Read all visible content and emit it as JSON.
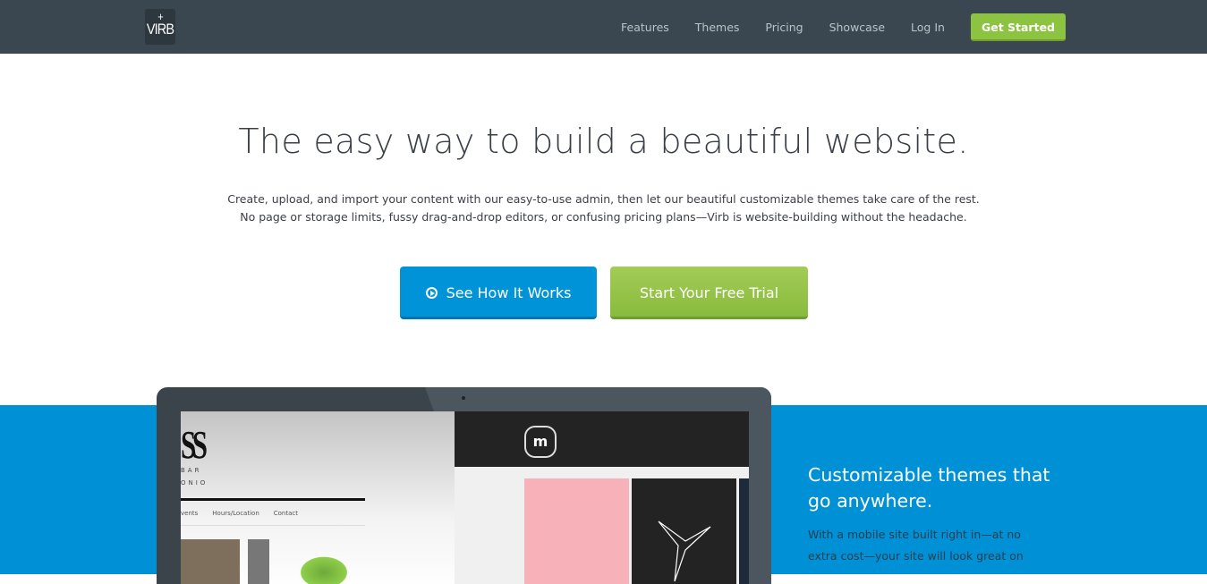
{
  "nav": {
    "logo": "VIRB",
    "logo_mark": "+",
    "links": [
      "Features",
      "Themes",
      "Pricing",
      "Showcase",
      "Log In"
    ],
    "cta": "Get Started"
  },
  "hero": {
    "title": "The easy way to build a beautiful website.",
    "subtitle_lines": [
      "Create, upload, and import your content with our easy-to-use admin, then let our beautiful customizable themes take care of the rest.",
      "No page or storage limits, fussy drag-and-drop editors, or confusing pricing plans—Virb is website-building without the headache."
    ],
    "buttons": {
      "primary": "See How It Works",
      "primary_icon": "play-circle-icon",
      "secondary": "Start Your Free Trial"
    }
  },
  "device": {
    "left_theme": {
      "logo": "SS",
      "tag1": "BAR",
      "tag2": "ONIO",
      "menu": [
        "vents",
        "Hours/Location",
        "Contact"
      ]
    },
    "right_theme": {
      "logo": "m"
    }
  },
  "feature": {
    "title": "Customizable themes that go anywhere.",
    "body": "With a mobile site built right in—at no extra cost—your site will look great on"
  },
  "colors": {
    "nav_bg": "#3b4750",
    "accent_blue": "#0090d6",
    "accent_green": "#8cc341"
  }
}
